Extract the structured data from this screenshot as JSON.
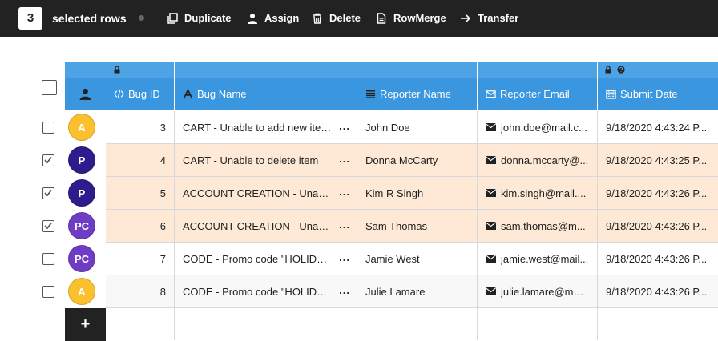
{
  "toolbar": {
    "selected_count": "3",
    "selected_label": "selected rows",
    "actions": [
      {
        "label": "Duplicate",
        "icon": "copy-icon"
      },
      {
        "label": "Assign",
        "icon": "user-icon"
      },
      {
        "label": "Delete",
        "icon": "trash-icon"
      },
      {
        "label": "RowMerge",
        "icon": "document-icon"
      },
      {
        "label": "Transfer",
        "icon": "arrow-right-icon"
      }
    ]
  },
  "grid": {
    "columns": [
      {
        "label": "Bug ID",
        "icon": "code-icon",
        "locked": true
      },
      {
        "label": "Bug Name",
        "icon": "font-icon"
      },
      {
        "label": "Reporter Name",
        "icon": "align-justify-icon"
      },
      {
        "label": "Reporter Email",
        "icon": "envelope-icon"
      },
      {
        "label": "Submit Date",
        "icon": "calendar-icon",
        "locked": true,
        "help": true
      }
    ],
    "rows": [
      {
        "avatar": "A",
        "avatar_color": "#fbc02d",
        "checked": false,
        "id": "3",
        "name": "CART - Unable to add new item to",
        "reporter": "John Doe",
        "email": "john.doe@mail.c...",
        "date": "9/18/2020 4:43:24 P..."
      },
      {
        "avatar": "P",
        "avatar_color": "#2e1b8c",
        "checked": true,
        "id": "4",
        "name": "CART - Unable to delete item",
        "reporter": "Donna McCarty",
        "email": "donna.mccarty@...",
        "date": "9/18/2020 4:43:25 P..."
      },
      {
        "avatar": "P",
        "avatar_color": "#2e1b8c",
        "checked": true,
        "id": "5",
        "name": "ACCOUNT CREATION - Unable to",
        "reporter": "Kim R Singh",
        "email": "kim.singh@mail....",
        "date": "9/18/2020 4:43:26 P..."
      },
      {
        "avatar": "PC",
        "avatar_color": "#6f3cc4",
        "checked": true,
        "id": "6",
        "name": "ACCOUNT CREATION - Unable to",
        "reporter": "Sam Thomas",
        "email": "sam.thomas@m...",
        "date": "9/18/2020 4:43:26 P..."
      },
      {
        "avatar": "PC",
        "avatar_color": "#6f3cc4",
        "checked": false,
        "id": "7",
        "name": "CODE - Promo code \"HOLIDAY\"",
        "reporter": "Jamie West",
        "email": "jamie.west@mail...",
        "date": "9/18/2020 4:43:26 P..."
      },
      {
        "avatar": "A",
        "avatar_color": "#fbc02d",
        "checked": false,
        "id": "8",
        "name": "CODE - Promo code \"HOLIDAY\"",
        "reporter": "Julie Lamare",
        "email": "julie.lamare@mai...",
        "date": "9/18/2020 4:43:26 P..."
      }
    ],
    "more_label": "...",
    "add_label": "+"
  },
  "colors": {
    "toolbar_bg": "#222222",
    "header_bg": "#3a96de",
    "header_top_bg": "#4ea3e5",
    "selected_row_bg": "#fde9d6"
  }
}
